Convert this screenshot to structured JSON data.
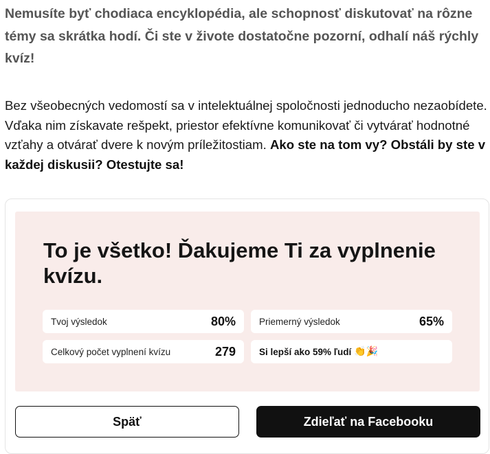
{
  "intro": {
    "text": "Nemusíte byť chodiaca encyklopédia, ale schopnosť diskutovať na rôzne témy sa skrátka hodí. Či ste v živote dostatočne pozorní, odhalí náš rýchly kvíz!"
  },
  "body": {
    "text": "Bez všeobecných vedomostí sa v intelektuálnej spoločnosti jednoducho nezaobídete. Vďaka nim získavate rešpekt, priestor efektívne komunikovať či vytvárať hodnotné vzťahy a otvárať dvere k novým príležitostiam. ",
    "bold": "Ako ste na tom vy? Obstáli by ste v každej diskusii? Otestujte sa!"
  },
  "result": {
    "title": "To je všetko! Ďakujeme Ti za vyplnenie kvízu.",
    "your_score_label": "Tvoj výsledok",
    "your_score_value": "80%",
    "avg_score_label": "Priemerný výsledok",
    "avg_score_value": "65%",
    "total_label": "Celkový počet vyplnení kvízu",
    "total_value": "279",
    "better_than": "Si lepší ako 59% ľudí",
    "better_emoji": "👏🎉"
  },
  "buttons": {
    "back": "Späť",
    "share": "Zdieľať na Facebooku"
  }
}
